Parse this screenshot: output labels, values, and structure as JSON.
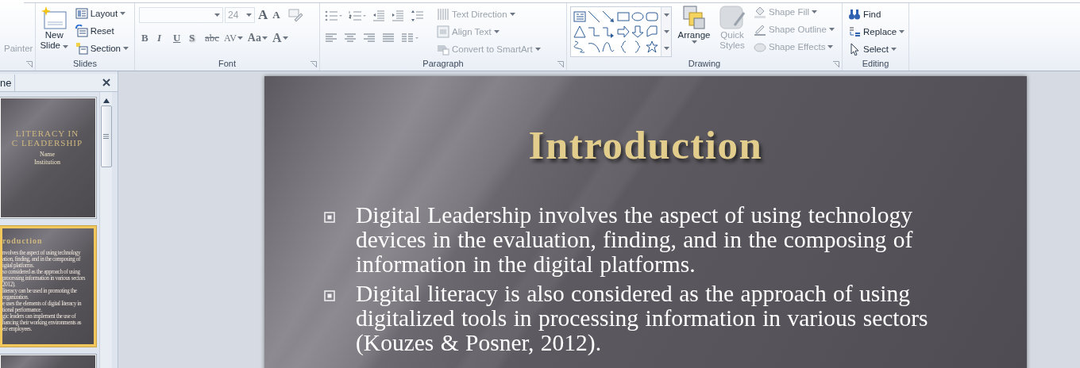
{
  "ribbon": {
    "clipboard": {
      "painter": {
        "label": "Painter",
        "disabled": true
      }
    },
    "slides_group": {
      "label": "Slides",
      "new_slide": {
        "label": "New Slide",
        "dropdown": true
      },
      "buttons": [
        {
          "kind": "layout",
          "label": "Layout",
          "dropdown": true
        },
        {
          "kind": "reset",
          "label": "Reset",
          "dropdown": false
        },
        {
          "kind": "section",
          "label": "Section",
          "dropdown": true
        }
      ]
    },
    "font_group": {
      "label": "Font",
      "font_size": "24",
      "grow": "A",
      "shrink": "A",
      "format_buttons": [
        {
          "kind": "bold",
          "label": "B",
          "dropdown": false
        },
        {
          "kind": "italic",
          "label": "I",
          "dropdown": false
        },
        {
          "kind": "underline",
          "label": "U",
          "dropdown": false
        },
        {
          "kind": "shadow",
          "label": "S",
          "dropdown": false
        },
        {
          "kind": "strike",
          "label": "abc",
          "dropdown": false
        },
        {
          "kind": "spacing",
          "label": "AV",
          "dropdown": true
        },
        {
          "kind": "case",
          "label": "Aa",
          "dropdown": true
        },
        {
          "kind": "color",
          "label": "A",
          "dropdown": true
        }
      ]
    },
    "paragraph_group": {
      "label": "Paragraph",
      "commands": [
        {
          "kind": "direction",
          "label": "Text Direction",
          "dropdown": true,
          "disabled": true
        },
        {
          "kind": "align",
          "label": "Align Text",
          "dropdown": true,
          "disabled": true
        },
        {
          "kind": "smartart",
          "label": "Convert to SmartArt",
          "dropdown": true,
          "disabled": true
        }
      ]
    },
    "drawing_group": {
      "label": "Drawing",
      "arrange": {
        "label": "Arrange",
        "disabled": false
      },
      "quick_styles": {
        "label": "Quick Styles",
        "disabled": true
      },
      "commands": [
        {
          "kind": "fill",
          "label": "Shape Fill",
          "dropdown": true,
          "disabled": true
        },
        {
          "kind": "outline",
          "label": "Shape Outline",
          "dropdown": true,
          "disabled": true
        },
        {
          "kind": "effects",
          "label": "Shape Effects",
          "dropdown": true,
          "disabled": true
        }
      ]
    },
    "editing_group": {
      "label": "Editing",
      "commands": [
        {
          "kind": "find",
          "label": "Find",
          "dropdown": false
        },
        {
          "kind": "replace",
          "label": "Replace",
          "dropdown": true
        },
        {
          "kind": "select",
          "label": "Select",
          "dropdown": true
        }
      ]
    }
  },
  "slides_pane": {
    "tab": "ne",
    "thumbnails": [
      {
        "selected": false,
        "title_lines": [
          "LITERACY  IN",
          "C  LEADERSHIP"
        ],
        "lines": [
          "Name",
          "Institution"
        ]
      },
      {
        "selected": true,
        "title_lines": [
          "roduction"
        ],
        "lines": [
          "nvolves the aspect of using technology",
          "ation, finding, and in the composing of",
          "igital platforms.",
          "so considered as the approach of using",
          "processing information in various sectors",
          "2012).",
          "literacy can be used in promoting the",
          "organization.",
          "e uses the elements of digital literacy in",
          "tional performance.",
          "gic leaders can implement the use of",
          "hancing their working environments as",
          "eir employees."
        ]
      },
      {
        "selected": false
      }
    ]
  },
  "slide": {
    "title": "Introduction",
    "bullets": [
      "Digital Leadership involves the aspect of using technology devices in the evaluation, finding, and in the composing of information in the digital platforms.",
      "Digital literacy is also considered as the approach of using digitalized tools in processing information in various sectors (Kouzes & Posner, 2012)."
    ]
  }
}
